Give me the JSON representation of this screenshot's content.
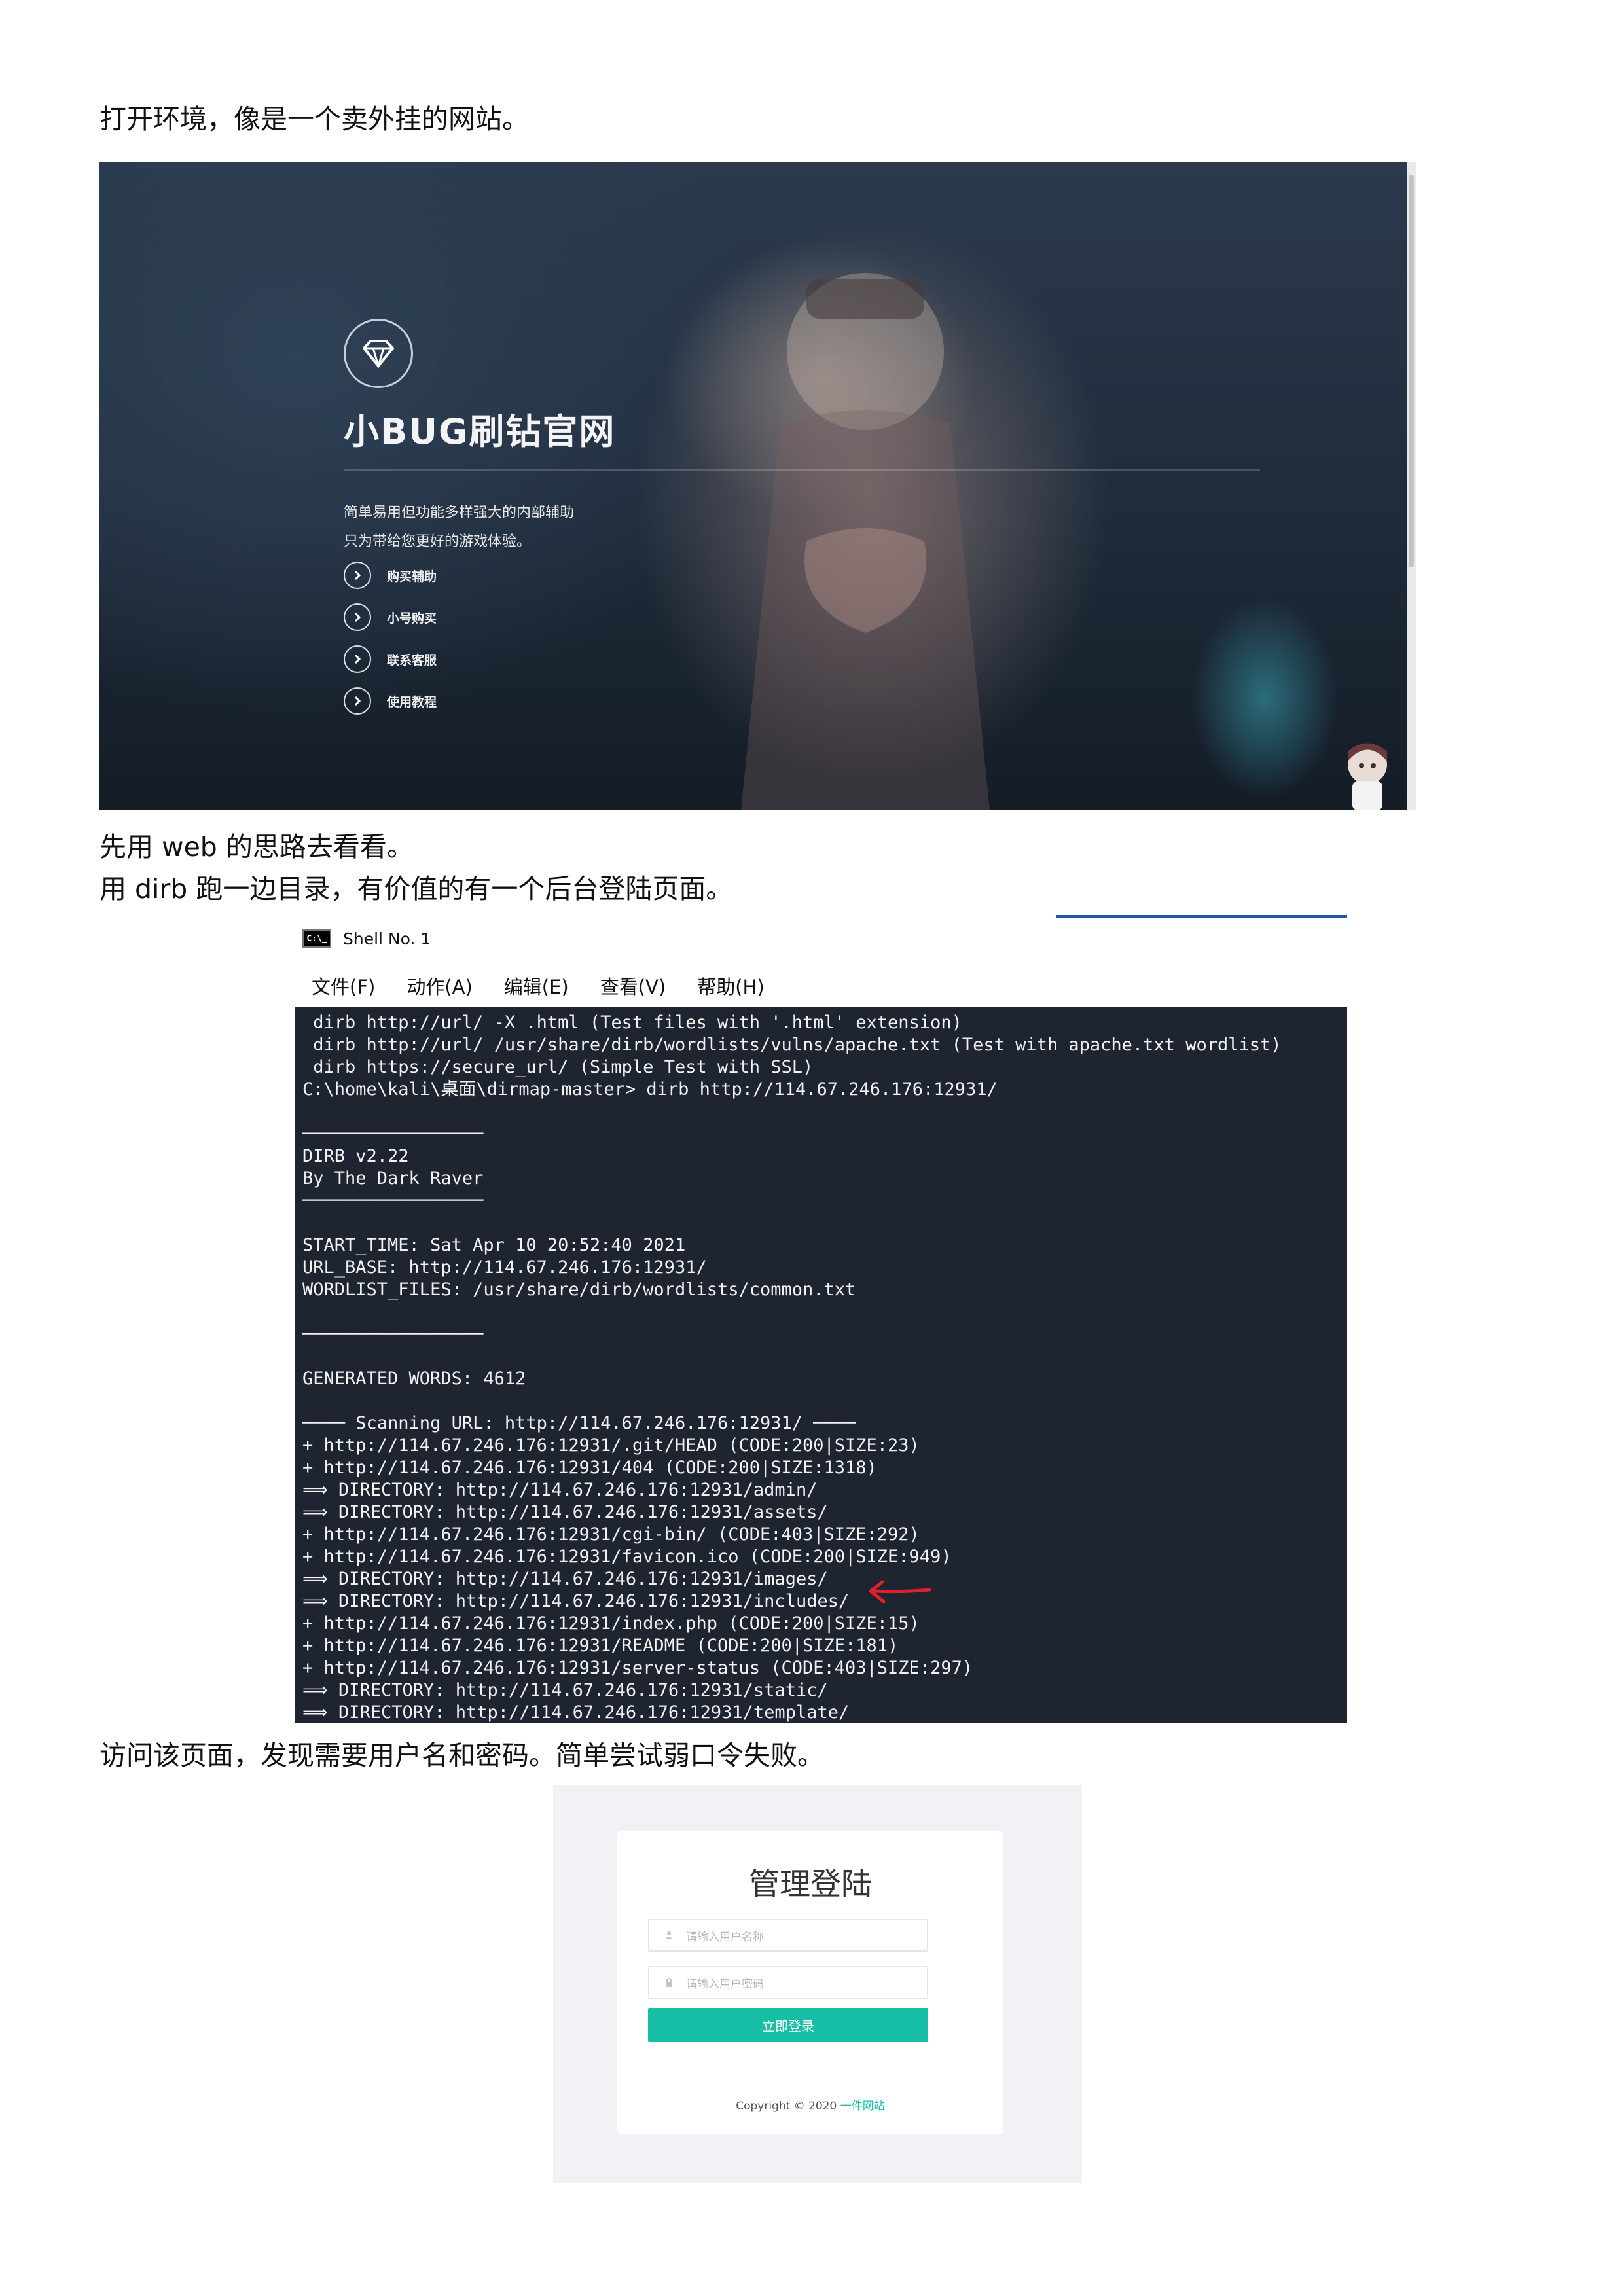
{
  "paragraphs": {
    "intro": "打开环境，像是一个卖外挂的网站。",
    "web_approach": "先用 web 的思路去看看。",
    "dirb_scan": "用 dirb 跑一边目录，有价值的有一个后台登陆页面。",
    "login_visit": "访问该页面，发现需要用户名和密码。简单尝试弱口令失败。"
  },
  "site": {
    "title": "小BUG刷钻官网",
    "desc_lines": [
      "简单易用但功能多样强大的内部辅助",
      "只为带给您更好的游戏体验。"
    ],
    "menu": [
      "购买辅助",
      "小号购买",
      "联系客服",
      "使用教程"
    ],
    "logo_icon": "diamond-icon"
  },
  "terminal": {
    "icon_text": "C:\\_",
    "title": "Shell No. 1",
    "menu": [
      "文件(F)",
      "动作(A)",
      "编辑(E)",
      "查看(V)",
      "帮助(H)"
    ],
    "lines": [
      " dirb http://url/ -X .html (Test files with '.html' extension)",
      " dirb http://url/ /usr/share/dirb/wordlists/vulns/apache.txt (Test with apache.txt wordlist)",
      " dirb https://secure_url/ (Simple Test with SSL)",
      "C:\\home\\kali\\桌面\\dirmap-master> dirb http://114.67.246.176:12931/",
      "",
      "─────────────────",
      "DIRB v2.22",
      "By The Dark Raver",
      "─────────────────",
      "",
      "START_TIME: Sat Apr 10 20:52:40 2021",
      "URL_BASE: http://114.67.246.176:12931/",
      "WORDLIST_FILES: /usr/share/dirb/wordlists/common.txt",
      "",
      "─────────────────",
      "",
      "GENERATED WORDS: 4612",
      "",
      "──── Scanning URL: http://114.67.246.176:12931/ ────",
      "+ http://114.67.246.176:12931/.git/HEAD (CODE:200|SIZE:23)",
      "+ http://114.67.246.176:12931/404 (CODE:200|SIZE:1318)",
      "⟹ DIRECTORY: http://114.67.246.176:12931/admin/",
      "⟹ DIRECTORY: http://114.67.246.176:12931/assets/",
      "+ http://114.67.246.176:12931/cgi-bin/ (CODE:403|SIZE:292)",
      "+ http://114.67.246.176:12931/favicon.ico (CODE:200|SIZE:949)",
      "⟹ DIRECTORY: http://114.67.246.176:12931/images/",
      "⟹ DIRECTORY: http://114.67.246.176:12931/includes/",
      "+ http://114.67.246.176:12931/index.php (CODE:200|SIZE:15)",
      "+ http://114.67.246.176:12931/README (CODE:200|SIZE:181)",
      "+ http://114.67.246.176:12931/server-status (CODE:403|SIZE:297)",
      "⟹ DIRECTORY: http://114.67.246.176:12931/static/",
      "⟹ DIRECTORY: http://114.67.246.176:12931/template/"
    ],
    "annotation_color": "#e0202a"
  },
  "login": {
    "title": "管理登陆",
    "username_placeholder": "请输入用户名称",
    "password_placeholder": "请输入用户密码",
    "submit_label": "立即登录",
    "copyright": "Copyright © 2020",
    "site_link": "一件网站",
    "accent_color": "#16bfa5"
  }
}
